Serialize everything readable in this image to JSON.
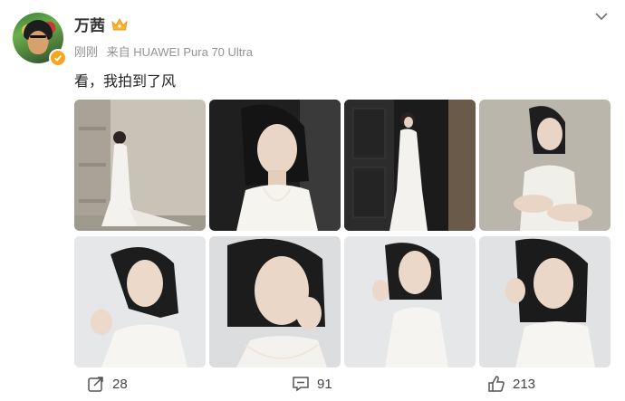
{
  "user": {
    "name": "万茜",
    "meta_time": "刚刚",
    "meta_source": "来自 HUAWEI Pura 70 Ultra",
    "avatar_icon": "frida-portrait-avatar",
    "badge_icon": "verified-badge-icon",
    "member_icon": "vip-crown-icon"
  },
  "post": {
    "text": "看，我拍到了风",
    "photos": [
      {
        "scene": "wall-white-dress",
        "tone": "#c9c4b8"
      },
      {
        "scene": "portrait-dark",
        "tone": "#2a2a2a"
      },
      {
        "scene": "door-dark",
        "tone": "#1e1e1e"
      },
      {
        "scene": "seated-wall",
        "tone": "#b9b5aa"
      },
      {
        "scene": "studio-hand",
        "tone": "#e4e6e8"
      },
      {
        "scene": "studio-closeup",
        "tone": "#dedfe0"
      },
      {
        "scene": "studio-pose",
        "tone": "#e6e7e9"
      },
      {
        "scene": "studio-hair",
        "tone": "#e2e3e5"
      }
    ]
  },
  "actions": {
    "share_count": "28",
    "comment_count": "91",
    "like_count": "213"
  },
  "colors": {
    "verified": "#f5a623",
    "meta": "#939393"
  }
}
